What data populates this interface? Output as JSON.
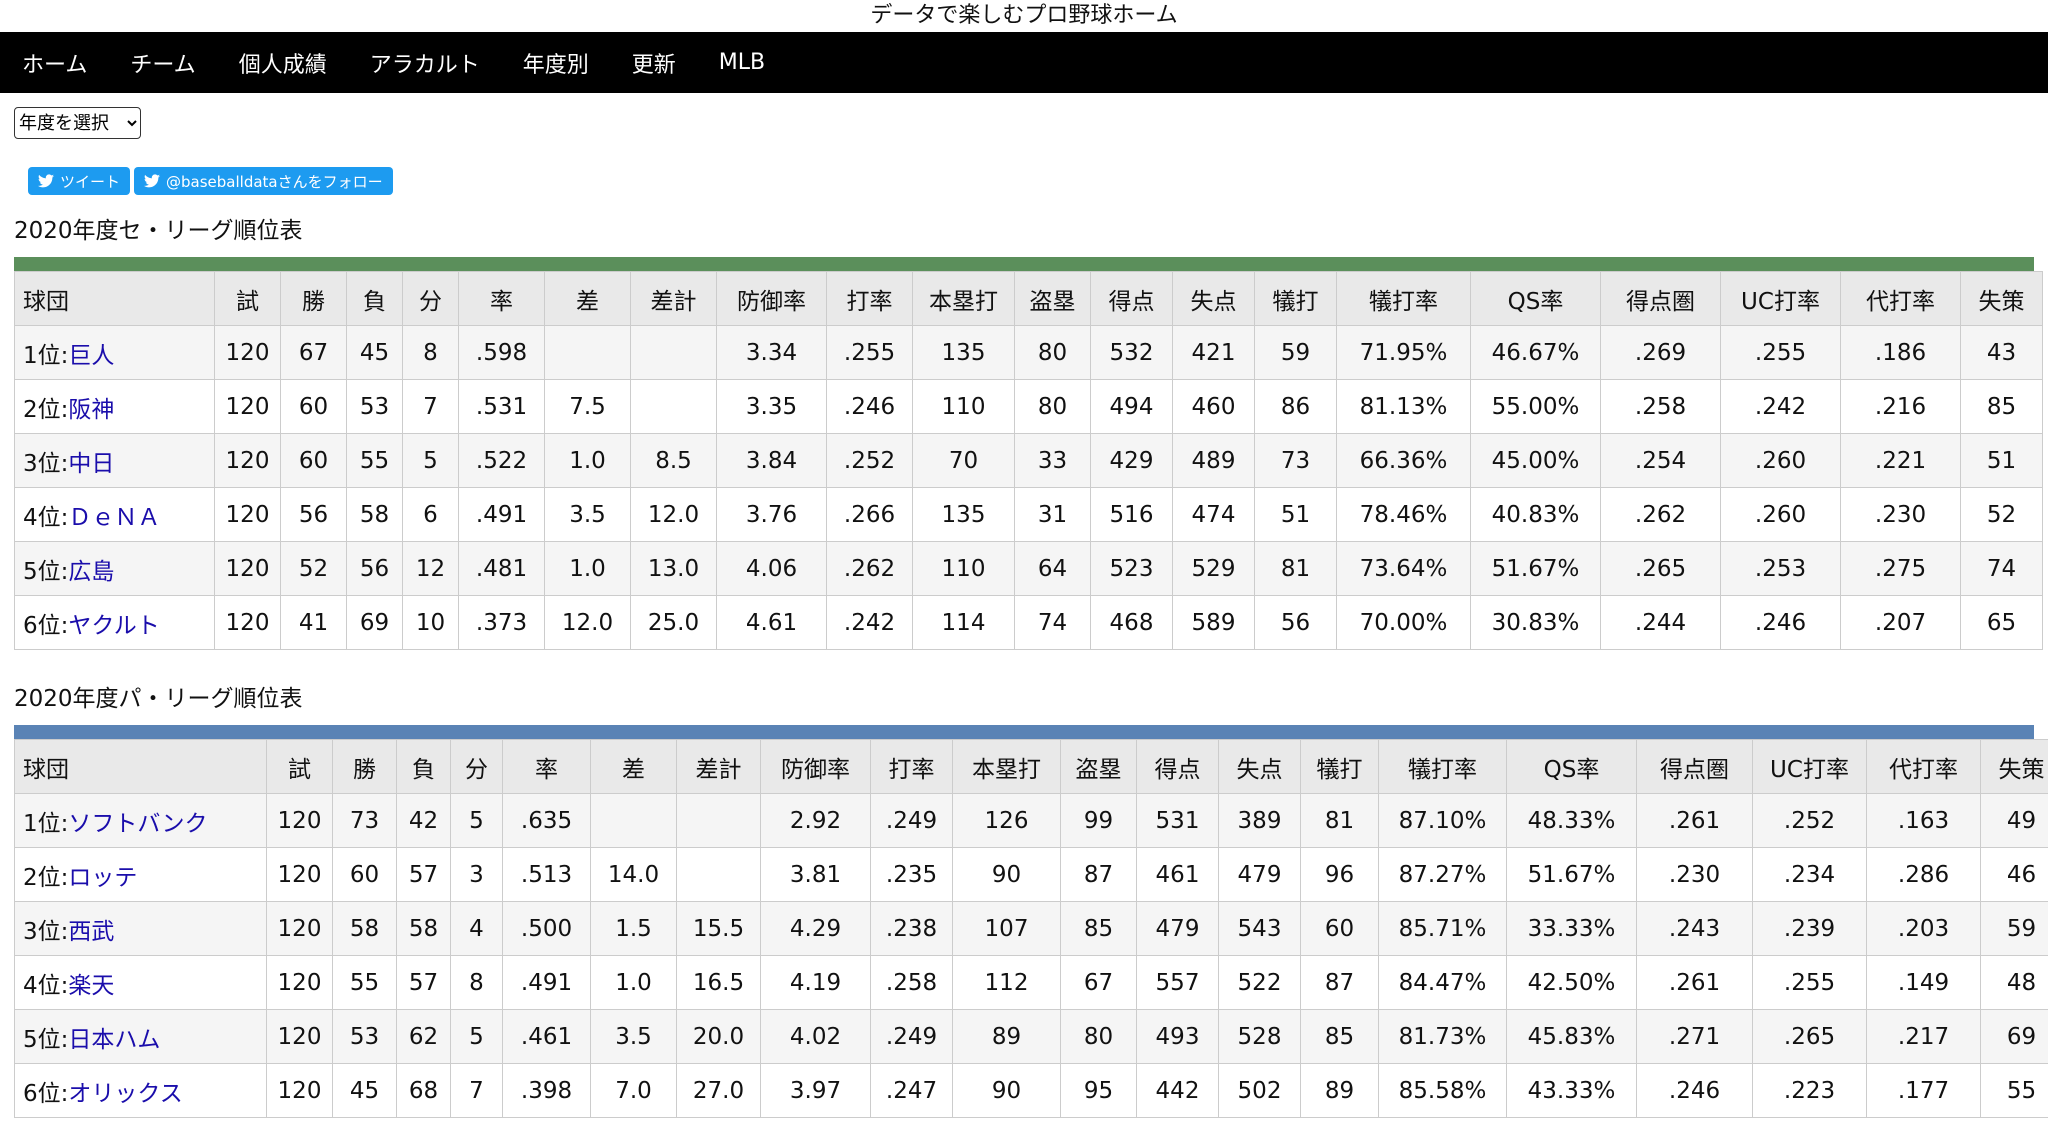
{
  "site_title": "データで楽しむプロ野球ホーム",
  "nav": [
    "ホーム",
    "チーム",
    "個人成績",
    "アラカルト",
    "年度別",
    "更新",
    "MLB"
  ],
  "year_select": {
    "selected": "年度を選択"
  },
  "social": {
    "tweet_label": "ツイート",
    "follow_label": "@baseballdataさんをフォロー"
  },
  "colors": {
    "central_bar": "#5b8f5b",
    "pacific_bar": "#5a83b5",
    "link": "#1a0dab"
  },
  "central": {
    "title": "2020年度セ・リーグ順位表",
    "headers": [
      "球団",
      "試",
      "勝",
      "負",
      "分",
      "率",
      "差",
      "差計",
      "防御率",
      "打率",
      "本塁打",
      "盗塁",
      "得点",
      "失点",
      "犠打",
      "犠打率",
      "QS率",
      "得点圏",
      "UC打率",
      "代打率",
      "失策"
    ],
    "rows": [
      {
        "rank": "1位:",
        "team": "巨人",
        "cells": [
          "120",
          "67",
          "45",
          "8",
          ".598",
          "",
          "",
          "3.34",
          ".255",
          "135",
          "80",
          "532",
          "421",
          "59",
          "71.95%",
          "46.67%",
          ".269",
          ".255",
          ".186",
          "43"
        ]
      },
      {
        "rank": "2位:",
        "team": "阪神",
        "cells": [
          "120",
          "60",
          "53",
          "7",
          ".531",
          "7.5",
          "",
          "3.35",
          ".246",
          "110",
          "80",
          "494",
          "460",
          "86",
          "81.13%",
          "55.00%",
          ".258",
          ".242",
          ".216",
          "85"
        ]
      },
      {
        "rank": "3位:",
        "team": "中日",
        "cells": [
          "120",
          "60",
          "55",
          "5",
          ".522",
          "1.0",
          "8.5",
          "3.84",
          ".252",
          "70",
          "33",
          "429",
          "489",
          "73",
          "66.36%",
          "45.00%",
          ".254",
          ".260",
          ".221",
          "51"
        ]
      },
      {
        "rank": "4位:",
        "team": "ＤｅＮＡ",
        "cells": [
          "120",
          "56",
          "58",
          "6",
          ".491",
          "3.5",
          "12.0",
          "3.76",
          ".266",
          "135",
          "31",
          "516",
          "474",
          "51",
          "78.46%",
          "40.83%",
          ".262",
          ".260",
          ".230",
          "52"
        ]
      },
      {
        "rank": "5位:",
        "team": "広島",
        "cells": [
          "120",
          "52",
          "56",
          "12",
          ".481",
          "1.0",
          "13.0",
          "4.06",
          ".262",
          "110",
          "64",
          "523",
          "529",
          "81",
          "73.64%",
          "51.67%",
          ".265",
          ".253",
          ".275",
          "74"
        ]
      },
      {
        "rank": "6位:",
        "team": "ヤクルト",
        "cells": [
          "120",
          "41",
          "69",
          "10",
          ".373",
          "12.0",
          "25.0",
          "4.61",
          ".242",
          "114",
          "74",
          "468",
          "589",
          "56",
          "70.00%",
          "30.83%",
          ".244",
          ".246",
          ".207",
          "65"
        ]
      }
    ]
  },
  "pacific": {
    "title": "2020年度パ・リーグ順位表",
    "headers": [
      "球団",
      "試",
      "勝",
      "負",
      "分",
      "率",
      "差",
      "差計",
      "防御率",
      "打率",
      "本塁打",
      "盗塁",
      "得点",
      "失点",
      "犠打",
      "犠打率",
      "QS率",
      "得点圏",
      "UC打率",
      "代打率",
      "失策"
    ],
    "rows": [
      {
        "rank": "1位:",
        "team": "ソフトバンク",
        "cells": [
          "120",
          "73",
          "42",
          "5",
          ".635",
          "",
          "",
          "2.92",
          ".249",
          "126",
          "99",
          "531",
          "389",
          "81",
          "87.10%",
          "48.33%",
          ".261",
          ".252",
          ".163",
          "49"
        ]
      },
      {
        "rank": "2位:",
        "team": "ロッテ",
        "cells": [
          "120",
          "60",
          "57",
          "3",
          ".513",
          "14.0",
          "",
          "3.81",
          ".235",
          "90",
          "87",
          "461",
          "479",
          "96",
          "87.27%",
          "51.67%",
          ".230",
          ".234",
          ".286",
          "46"
        ]
      },
      {
        "rank": "3位:",
        "team": "西武",
        "cells": [
          "120",
          "58",
          "58",
          "4",
          ".500",
          "1.5",
          "15.5",
          "4.29",
          ".238",
          "107",
          "85",
          "479",
          "543",
          "60",
          "85.71%",
          "33.33%",
          ".243",
          ".239",
          ".203",
          "59"
        ]
      },
      {
        "rank": "4位:",
        "team": "楽天",
        "cells": [
          "120",
          "55",
          "57",
          "8",
          ".491",
          "1.0",
          "16.5",
          "4.19",
          ".258",
          "112",
          "67",
          "557",
          "522",
          "87",
          "84.47%",
          "42.50%",
          ".261",
          ".255",
          ".149",
          "48"
        ]
      },
      {
        "rank": "5位:",
        "team": "日本ハム",
        "cells": [
          "120",
          "53",
          "62",
          "5",
          ".461",
          "3.5",
          "20.0",
          "4.02",
          ".249",
          "89",
          "80",
          "493",
          "528",
          "85",
          "81.73%",
          "45.83%",
          ".271",
          ".265",
          ".217",
          "69"
        ]
      },
      {
        "rank": "6位:",
        "team": "オリックス",
        "cells": [
          "120",
          "45",
          "68",
          "7",
          ".398",
          "7.0",
          "27.0",
          "3.97",
          ".247",
          "90",
          "95",
          "442",
          "502",
          "89",
          "85.58%",
          "43.33%",
          ".246",
          ".223",
          ".177",
          "55"
        ]
      }
    ]
  }
}
